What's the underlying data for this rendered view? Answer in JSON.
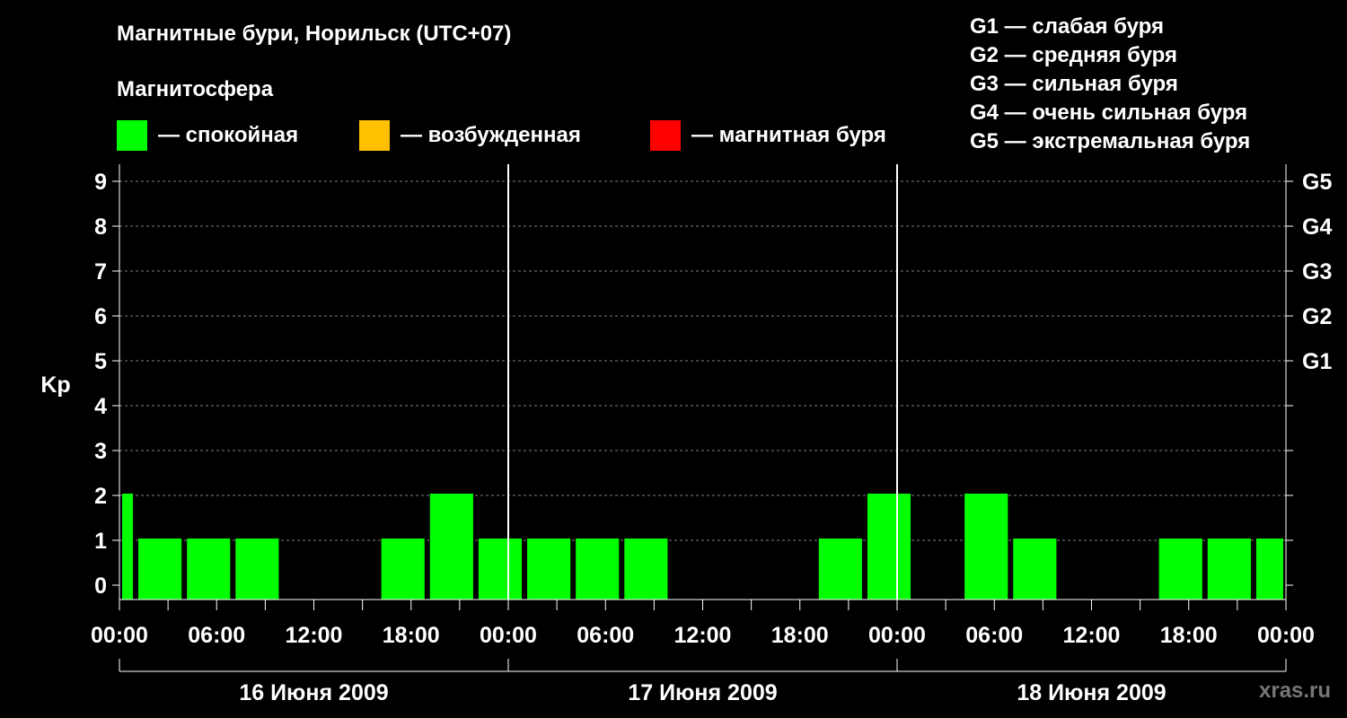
{
  "title": "Магнитные бури, Норильск (UTC+07)",
  "subtitle": "Магнитосфера",
  "legend": [
    {
      "label": "— спокойная",
      "color": "#00ff00"
    },
    {
      "label": "— возбужденная",
      "color": "#ffc000"
    },
    {
      "label": "— магнитная буря",
      "color": "#ff0000"
    }
  ],
  "g_levels": [
    "G1 — слабая буря",
    "G2 — средняя буря",
    "G3 — сильная буря",
    "G4 — очень сильная буря",
    "G5 — экстремальная буря"
  ],
  "watermark": "xras.ru",
  "chart_data": {
    "type": "bar",
    "ylabel": "Kp",
    "ylim": [
      0,
      9
    ],
    "yticks": [
      "0",
      "1",
      "2",
      "3",
      "4",
      "5",
      "6",
      "7",
      "8",
      "9"
    ],
    "right_ticks": [
      {
        "value": 5,
        "label": "G1"
      },
      {
        "value": 6,
        "label": "G2"
      },
      {
        "value": 7,
        "label": "G3"
      },
      {
        "value": 8,
        "label": "G4"
      },
      {
        "value": 9,
        "label": "G5"
      }
    ],
    "xticks": [
      "00:00",
      "06:00",
      "12:00",
      "18:00",
      "00:00",
      "06:00",
      "12:00",
      "18:00",
      "00:00",
      "06:00",
      "12:00",
      "18:00",
      "00:00"
    ],
    "days": [
      "16 Июня 2009",
      "17 Июня 2009",
      "18 Июня 2009"
    ],
    "grid": true,
    "bar_color": "#00ff00",
    "bars": [
      {
        "start": "2009-06-16 00:00",
        "end": "2009-06-16 01:00",
        "kp": 2
      },
      {
        "start": "2009-06-16 01:00",
        "end": "2009-06-16 04:00",
        "kp": 1
      },
      {
        "start": "2009-06-16 04:00",
        "end": "2009-06-16 07:00",
        "kp": 1
      },
      {
        "start": "2009-06-16 07:00",
        "end": "2009-06-16 10:00",
        "kp": 1
      },
      {
        "start": "2009-06-16 10:00",
        "end": "2009-06-16 13:00",
        "kp": 0
      },
      {
        "start": "2009-06-16 13:00",
        "end": "2009-06-16 16:00",
        "kp": 0
      },
      {
        "start": "2009-06-16 16:00",
        "end": "2009-06-16 19:00",
        "kp": 1
      },
      {
        "start": "2009-06-16 19:00",
        "end": "2009-06-16 22:00",
        "kp": 2
      },
      {
        "start": "2009-06-16 22:00",
        "end": "2009-06-17 01:00",
        "kp": 1
      },
      {
        "start": "2009-06-17 01:00",
        "end": "2009-06-17 04:00",
        "kp": 1
      },
      {
        "start": "2009-06-17 04:00",
        "end": "2009-06-17 07:00",
        "kp": 1
      },
      {
        "start": "2009-06-17 07:00",
        "end": "2009-06-17 10:00",
        "kp": 1
      },
      {
        "start": "2009-06-17 10:00",
        "end": "2009-06-17 13:00",
        "kp": 0
      },
      {
        "start": "2009-06-17 13:00",
        "end": "2009-06-17 16:00",
        "kp": 0
      },
      {
        "start": "2009-06-17 16:00",
        "end": "2009-06-17 19:00",
        "kp": 0
      },
      {
        "start": "2009-06-17 19:00",
        "end": "2009-06-17 22:00",
        "kp": 1
      },
      {
        "start": "2009-06-17 22:00",
        "end": "2009-06-18 01:00",
        "kp": 2
      },
      {
        "start": "2009-06-18 01:00",
        "end": "2009-06-18 04:00",
        "kp": 0
      },
      {
        "start": "2009-06-18 04:00",
        "end": "2009-06-18 07:00",
        "kp": 2
      },
      {
        "start": "2009-06-18 07:00",
        "end": "2009-06-18 10:00",
        "kp": 1
      },
      {
        "start": "2009-06-18 10:00",
        "end": "2009-06-18 13:00",
        "kp": 0
      },
      {
        "start": "2009-06-18 13:00",
        "end": "2009-06-18 16:00",
        "kp": 0
      },
      {
        "start": "2009-06-18 16:00",
        "end": "2009-06-18 19:00",
        "kp": 1
      },
      {
        "start": "2009-06-18 19:00",
        "end": "2009-06-18 22:00",
        "kp": 1
      },
      {
        "start": "2009-06-18 22:00",
        "end": "2009-06-19 00:00",
        "kp": 1
      }
    ]
  }
}
